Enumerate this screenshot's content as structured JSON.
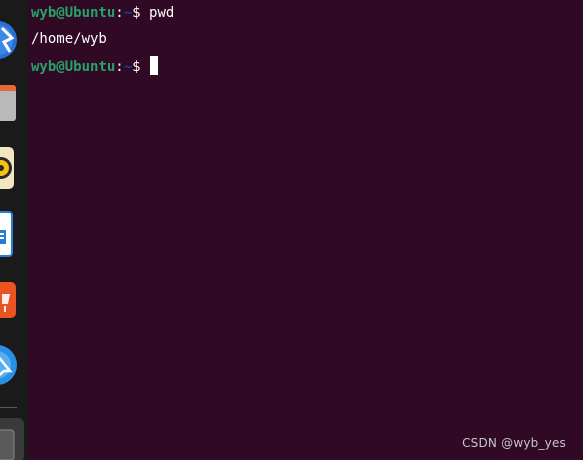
{
  "dock": {
    "items": [
      {
        "name": "browser",
        "icon": "browser-icon"
      },
      {
        "name": "files",
        "icon": "files-icon"
      },
      {
        "name": "music",
        "icon": "music-icon"
      },
      {
        "name": "writer",
        "icon": "document-icon"
      },
      {
        "name": "software",
        "icon": "software-icon"
      },
      {
        "name": "help",
        "icon": "help-icon"
      },
      {
        "name": "terminal",
        "icon": "terminal-icon"
      }
    ]
  },
  "terminal": {
    "lines": [
      {
        "user": "wyb@Ubuntu",
        "sep": ":",
        "path": "~",
        "prompt": "$ ",
        "command": "pwd"
      },
      {
        "output": "/home/wyb"
      },
      {
        "user": "wyb@Ubuntu",
        "sep": ":",
        "path": "~",
        "prompt": "$ ",
        "command": ""
      }
    ],
    "colors": {
      "background": "#300a24",
      "user": "#26a269",
      "path": "#12488b",
      "text": "#ffffff"
    }
  },
  "watermark": "CSDN @wyb_yes"
}
